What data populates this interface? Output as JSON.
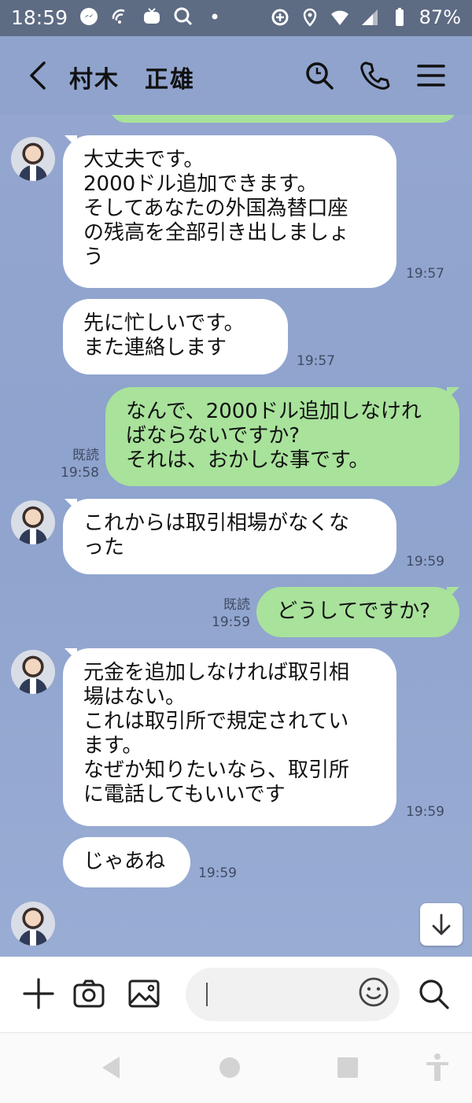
{
  "status_bar": {
    "time": "18:59",
    "battery": "87%"
  },
  "header": {
    "contact_name": "村木　正雄"
  },
  "messages": [
    {
      "side": "in",
      "text": "大丈夫です。\n2000ドル追加できます。\nそしてあなたの外国為替口座\nの残高を全部引き出しましょ\nう",
      "time": "19:57"
    },
    {
      "side": "in",
      "text": "先に忙しいです。\nまた連絡します",
      "time": "19:57"
    },
    {
      "side": "out",
      "text": "なんで、2000ドル追加しなけれ\nばならないですか?\nそれは、おかしな事です。",
      "read": "既読",
      "time": "19:58"
    },
    {
      "side": "in",
      "text": "これからは取引相場がなくな\nった",
      "time": "19:59"
    },
    {
      "side": "out",
      "text": "どうしてですか?",
      "read": "既読",
      "time": "19:59"
    },
    {
      "side": "in",
      "text": "元金を追加しなければ取引相\n場はない。\nこれは取引所で規定されてい\nます。\nなぜか知りたいなら、取引所\nに電話してもいいです",
      "time": "19:59"
    },
    {
      "side": "in",
      "text": "じゃあね",
      "time": "19:59"
    }
  ],
  "input": {
    "value": ""
  },
  "colors": {
    "chat_bg": "#8fa3cc",
    "incoming_bubble": "#ffffff",
    "outgoing_bubble": "#a8e29b",
    "status_bar": "#5d6b83"
  },
  "icons": {
    "back": "chevron-left-icon",
    "search": "search-icon",
    "call": "phone-icon",
    "menu": "menu-icon",
    "add": "plus-icon",
    "camera": "camera-icon",
    "image": "image-icon",
    "emoji": "smile-icon",
    "scroll_down": "arrow-down-icon"
  }
}
